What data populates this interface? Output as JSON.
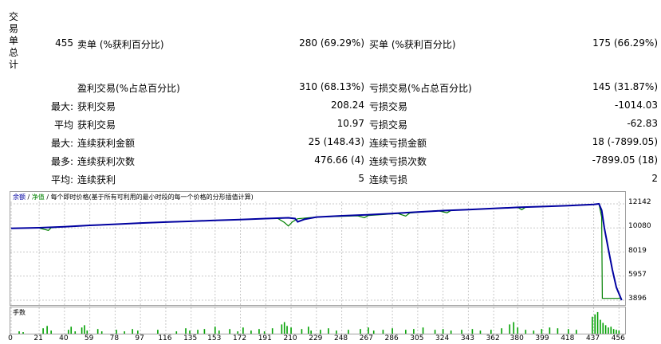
{
  "vertical_label": [
    "交",
    "易",
    "单",
    "总",
    "计"
  ],
  "rows": [
    {
      "c1": "455",
      "c2": "卖单 (%获利百分比)",
      "c3": "280 (69.29%)",
      "c4": "买单 (%获利百分比)",
      "c5": "175 (66.29%)"
    },
    {
      "c1": "",
      "c2": "盈利交易(%占总百分比)",
      "c3": "310 (68.13%)",
      "c4": "亏损交易(%占总百分比)",
      "c5": "145 (31.87%)"
    },
    {
      "c1": "最大:",
      "c2": "获利交易",
      "c3": "208.24",
      "c4": "亏损交易",
      "c5": "-1014.03"
    },
    {
      "c1": "平均",
      "c2": "获利交易",
      "c3": "10.97",
      "c4": "亏损交易",
      "c5": "-62.83"
    },
    {
      "c1": "最大:",
      "c2": "连续获利金额",
      "c3": "25 (148.43)",
      "c4": "连续亏损金额",
      "c5": "18 (-7899.05)"
    },
    {
      "c1": "最多:",
      "c2": "连续获利次数",
      "c3": "476.66 (4)",
      "c4": "连续亏损次数",
      "c5": "-7899.05 (18)"
    },
    {
      "c1": "平均:",
      "c2": "连续获利",
      "c3": "5",
      "c4": "连续亏损",
      "c5": "2"
    }
  ],
  "chart_header": {
    "balance": "余额",
    "sep1": " / ",
    "equity": "净值",
    "sep2": " / ",
    "desc": "每个即时价格(基于所有可利用的最小时段的每一个价格的分形插值计算)"
  },
  "volume_label": "手数",
  "colors": {
    "balance": "#0000a0",
    "equity": "#008000",
    "volume": "#00a000",
    "grid": "#c8c8c8"
  },
  "chart_data": {
    "type": "line",
    "ylim": [
      3896,
      12142
    ],
    "y_ticks": [
      "12142",
      "10080",
      "8019",
      "5957",
      "3896"
    ],
    "x_ticks": [
      "0",
      "21",
      "40",
      "59",
      "78",
      "97",
      "116",
      "135",
      "153",
      "172",
      "191",
      "210",
      "229",
      "248",
      "267",
      "286",
      "305",
      "324",
      "343",
      "362",
      "380",
      "399",
      "418",
      "437",
      "456"
    ],
    "x_range": [
      0,
      460
    ],
    "series": [
      {
        "key": "balance",
        "points": [
          [
            0,
            10050
          ],
          [
            21,
            10100
          ],
          [
            40,
            10180
          ],
          [
            59,
            10300
          ],
          [
            78,
            10400
          ],
          [
            97,
            10500
          ],
          [
            116,
            10580
          ],
          [
            135,
            10650
          ],
          [
            153,
            10730
          ],
          [
            172,
            10800
          ],
          [
            191,
            10880
          ],
          [
            208,
            10950
          ],
          [
            213,
            10880
          ],
          [
            215,
            10600
          ],
          [
            220,
            10820
          ],
          [
            229,
            11010
          ],
          [
            248,
            11120
          ],
          [
            267,
            11210
          ],
          [
            286,
            11320
          ],
          [
            305,
            11450
          ],
          [
            324,
            11560
          ],
          [
            343,
            11650
          ],
          [
            362,
            11750
          ],
          [
            380,
            11840
          ],
          [
            399,
            11910
          ],
          [
            418,
            11990
          ],
          [
            437,
            12090
          ],
          [
            441,
            12142
          ],
          [
            443,
            11600
          ],
          [
            445,
            10100
          ],
          [
            448,
            8300
          ],
          [
            451,
            6500
          ],
          [
            454,
            5000
          ],
          [
            458,
            3896
          ]
        ]
      },
      {
        "key": "equity",
        "points": [
          [
            0,
            10050
          ],
          [
            20,
            10100
          ],
          [
            28,
            9870
          ],
          [
            30,
            10100
          ],
          [
            40,
            10180
          ],
          [
            59,
            10300
          ],
          [
            97,
            10500
          ],
          [
            135,
            10650
          ],
          [
            172,
            10800
          ],
          [
            191,
            10880
          ],
          [
            200,
            10900
          ],
          [
            205,
            10550
          ],
          [
            208,
            10250
          ],
          [
            211,
            10600
          ],
          [
            215,
            10870
          ],
          [
            229,
            11010
          ],
          [
            260,
            11120
          ],
          [
            265,
            10960
          ],
          [
            268,
            11150
          ],
          [
            290,
            11320
          ],
          [
            296,
            11100
          ],
          [
            299,
            11360
          ],
          [
            320,
            11560
          ],
          [
            327,
            11380
          ],
          [
            330,
            11580
          ],
          [
            360,
            11740
          ],
          [
            380,
            11840
          ],
          [
            383,
            11640
          ],
          [
            386,
            11860
          ],
          [
            418,
            11990
          ],
          [
            437,
            12090
          ],
          [
            441,
            12142
          ],
          [
            443,
            11000
          ],
          [
            443.5,
            4050
          ],
          [
            458,
            4050
          ]
        ]
      }
    ],
    "volume_bars": [
      [
        6,
        3
      ],
      [
        9,
        2
      ],
      [
        24,
        7
      ],
      [
        27,
        10
      ],
      [
        30,
        4
      ],
      [
        43,
        5
      ],
      [
        45,
        9
      ],
      [
        48,
        3
      ],
      [
        53,
        8
      ],
      [
        55,
        11
      ],
      [
        57,
        4
      ],
      [
        65,
        6
      ],
      [
        68,
        3
      ],
      [
        79,
        5
      ],
      [
        85,
        3
      ],
      [
        91,
        6
      ],
      [
        95,
        4
      ],
      [
        110,
        5
      ],
      [
        124,
        3
      ],
      [
        131,
        7
      ],
      [
        134,
        4
      ],
      [
        140,
        5
      ],
      [
        145,
        6
      ],
      [
        153,
        9
      ],
      [
        156,
        4
      ],
      [
        164,
        6
      ],
      [
        170,
        3
      ],
      [
        174,
        8
      ],
      [
        180,
        4
      ],
      [
        186,
        6
      ],
      [
        190,
        3
      ],
      [
        196,
        7
      ],
      [
        203,
        12
      ],
      [
        205,
        15
      ],
      [
        207,
        10
      ],
      [
        210,
        8
      ],
      [
        218,
        6
      ],
      [
        223,
        9
      ],
      [
        225,
        4
      ],
      [
        232,
        5
      ],
      [
        238,
        7
      ],
      [
        244,
        4
      ],
      [
        253,
        5
      ],
      [
        262,
        6
      ],
      [
        268,
        8
      ],
      [
        272,
        4
      ],
      [
        279,
        5
      ],
      [
        286,
        7
      ],
      [
        296,
        5
      ],
      [
        302,
        6
      ],
      [
        309,
        8
      ],
      [
        318,
        5
      ],
      [
        324,
        6
      ],
      [
        330,
        4
      ],
      [
        338,
        5
      ],
      [
        346,
        6
      ],
      [
        352,
        4
      ],
      [
        360,
        5
      ],
      [
        368,
        7
      ],
      [
        374,
        12
      ],
      [
        377,
        15
      ],
      [
        380,
        8
      ],
      [
        386,
        5
      ],
      [
        392,
        4
      ],
      [
        398,
        6
      ],
      [
        404,
        8
      ],
      [
        410,
        7
      ],
      [
        418,
        6
      ],
      [
        424,
        5
      ],
      [
        436,
        22
      ],
      [
        438,
        25
      ],
      [
        440,
        28
      ],
      [
        442,
        18
      ],
      [
        444,
        14
      ],
      [
        446,
        11
      ],
      [
        448,
        8
      ],
      [
        450,
        9
      ],
      [
        452,
        6
      ],
      [
        454,
        5
      ],
      [
        456,
        4
      ]
    ]
  }
}
